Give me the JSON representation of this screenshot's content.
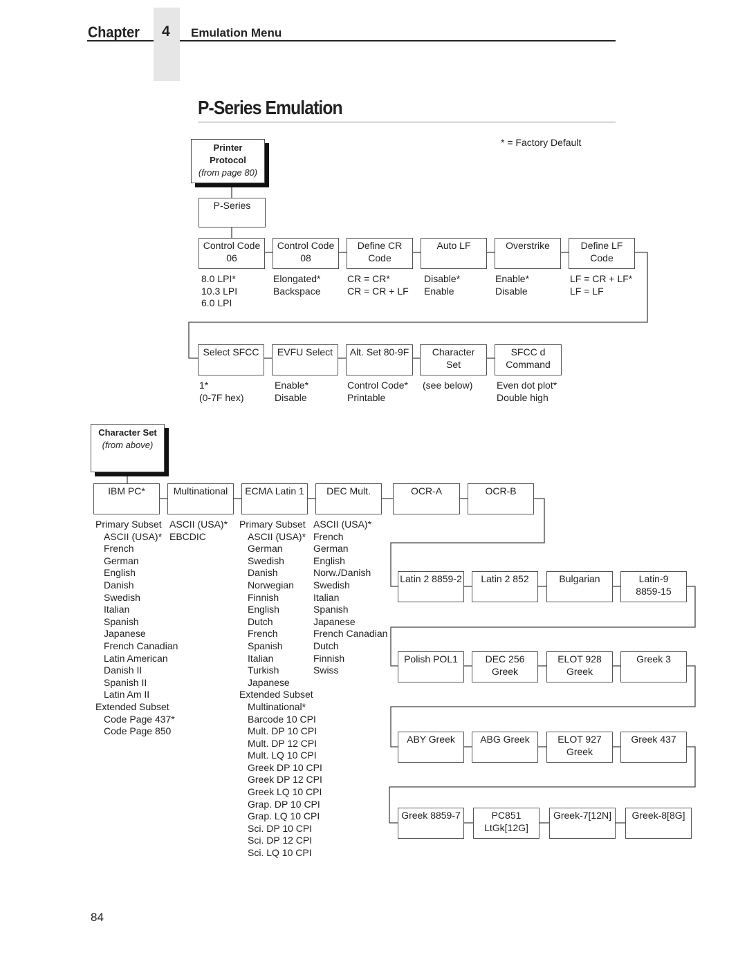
{
  "header": {
    "chapter_label": "Chapter",
    "chapter_number": "4",
    "section_title": "Emulation Menu"
  },
  "page_title": "P-Series Emulation",
  "legend": "* = Factory Default",
  "printer_protocol": {
    "title_line1": "Printer",
    "title_line2": "Protocol",
    "ref": "(from page 80)"
  },
  "pseries_box": "P-Series",
  "row1": [
    {
      "l1": "Control Code",
      "l2": "06",
      "opts": [
        "8.0 LPI*",
        "10.3 LPI",
        "6.0 LPI"
      ]
    },
    {
      "l1": "Control Code",
      "l2": "08",
      "opts": [
        "Elongated*",
        "Backspace"
      ]
    },
    {
      "l1": "Define CR",
      "l2": "Code",
      "opts": [
        "CR = CR*",
        "CR = CR + LF"
      ]
    },
    {
      "l1": "Auto LF",
      "l2": "",
      "opts": [
        "Disable*",
        "Enable"
      ]
    },
    {
      "l1": "Overstrike",
      "l2": "",
      "opts": [
        "Enable*",
        "Disable"
      ]
    },
    {
      "l1": "Define LF",
      "l2": "Code",
      "opts": [
        "LF = CR + LF*",
        "LF = LF"
      ]
    }
  ],
  "row2": [
    {
      "l1": "Select SFCC",
      "l2": "",
      "opts": [
        "1*",
        "(0-7F hex)"
      ]
    },
    {
      "l1": "EVFU Select",
      "l2": "",
      "opts": [
        "Enable*",
        "Disable"
      ]
    },
    {
      "l1": "Alt. Set 80-9F",
      "l2": "",
      "opts": [
        "Control Code*",
        "Printable"
      ]
    },
    {
      "l1": "Character",
      "l2": "Set",
      "opts": [
        "(see below)"
      ]
    },
    {
      "l1": "SFCC d",
      "l2": "Command",
      "opts": [
        "Even dot plot*",
        "Double high"
      ]
    }
  ],
  "charset_header": {
    "title": "Character Set",
    "ref": "(from above)"
  },
  "charset_row": [
    {
      "l1": "IBM PC*",
      "l2": ""
    },
    {
      "l1": "Multinational",
      "l2": ""
    },
    {
      "l1": "ECMA Latin 1",
      "l2": ""
    },
    {
      "l1": "DEC Mult.",
      "l2": ""
    },
    {
      "l1": "OCR-A",
      "l2": ""
    },
    {
      "l1": "OCR-B",
      "l2": ""
    }
  ],
  "ibm_pc_opts": {
    "primary_label": "Primary Subset",
    "primary": [
      "ASCII (USA)*",
      "French",
      "German",
      "English",
      "Danish",
      "Swedish",
      "Italian",
      "Spanish",
      "Japanese",
      "French Canadian",
      "Latin American",
      "Danish II",
      "Spanish II",
      "Latin Am II"
    ],
    "extended_label": "Extended Subset",
    "extended": [
      "Code Page 437*",
      "Code Page 850"
    ]
  },
  "multinational_opts": [
    "ASCII (USA)*",
    "EBCDIC"
  ],
  "ecma_opts": {
    "primary_label": "Primary Subset",
    "primary": [
      "ASCII (USA)*",
      "German",
      "Swedish",
      "Danish",
      "Norwegian",
      "Finnish",
      "English",
      "Dutch",
      "French",
      "Spanish",
      "Italian",
      "Turkish",
      "Japanese"
    ],
    "extended_label": "Extended Subset",
    "extended": [
      "Multinational*",
      "Barcode 10 CPI",
      "Mult. DP 10 CPI",
      "Mult. DP 12 CPI",
      "Mult. LQ 10 CPI",
      "Greek DP 10 CPI",
      "Greek DP 12 CPI",
      "Greek LQ 10 CPI",
      "Grap. DP 10 CPI",
      "Grap. LQ 10 CPI",
      "Sci. DP 10 CPI",
      "Sci. DP 12 CPI",
      "Sci. LQ 10 CPI"
    ]
  },
  "dec_mult_opts": [
    "ASCII (USA)*",
    "French",
    "German",
    "English",
    "Norw./Danish",
    "Swedish",
    "Italian",
    "Spanish",
    "Japanese",
    "French Canadian",
    "Dutch",
    "Finnish",
    "Swiss"
  ],
  "charset_rows_more": [
    [
      {
        "l1": "Latin 2 8859-2",
        "l2": ""
      },
      {
        "l1": "Latin 2 852",
        "l2": ""
      },
      {
        "l1": "Bulgarian",
        "l2": ""
      },
      {
        "l1": "Latin-9",
        "l2": "8859-15"
      }
    ],
    [
      {
        "l1": "Polish POL1",
        "l2": ""
      },
      {
        "l1": "DEC 256",
        "l2": "Greek"
      },
      {
        "l1": "ELOT 928",
        "l2": "Greek"
      },
      {
        "l1": "Greek 3",
        "l2": ""
      }
    ],
    [
      {
        "l1": "ABY Greek",
        "l2": ""
      },
      {
        "l1": "ABG Greek",
        "l2": ""
      },
      {
        "l1": "ELOT 927",
        "l2": "Greek"
      },
      {
        "l1": "Greek 437",
        "l2": ""
      }
    ],
    [
      {
        "l1": "Greek 8859-7",
        "l2": ""
      },
      {
        "l1": "PC851",
        "l2": "LtGk[12G]"
      },
      {
        "l1": "Greek-7[12N]",
        "l2": ""
      },
      {
        "l1": "Greek-8[8G]",
        "l2": ""
      }
    ]
  ],
  "page_number": "84"
}
